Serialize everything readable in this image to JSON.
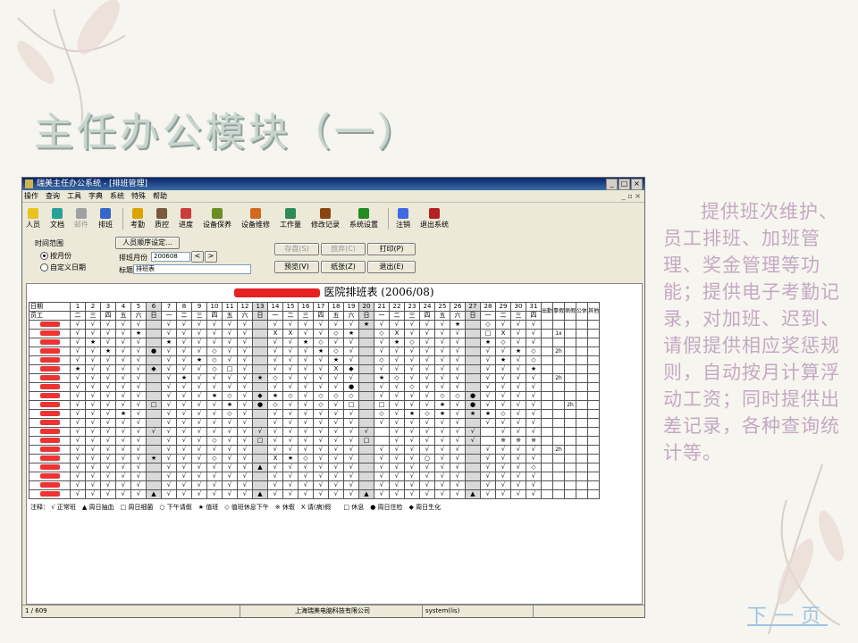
{
  "slide": {
    "title": "主任办公模块（一）",
    "description": "提供班次维护、员工排班、加班管理、奖金管理等功能；提供电子考勤记录，对加班、迟到、请假提供相应奖惩规则，自动按月计算浮动工资；同时提供出差记录，各种查询统计等。",
    "next_link": "下一页"
  },
  "window": {
    "title": "瑞美主任办公系统 - [排班管理]",
    "menu": [
      "操作",
      "查询",
      "工具",
      "字典",
      "系统",
      "特殊",
      "帮助"
    ],
    "toolbar": [
      {
        "label": "人员",
        "icon": "person-icon",
        "color": "#e8c31c",
        "disabled": false
      },
      {
        "label": "文档",
        "icon": "document-icon",
        "color": "#2aa198",
        "disabled": false
      },
      {
        "label": "邮件",
        "icon": "mail-icon",
        "color": "#a0a0a0",
        "disabled": true
      },
      {
        "label": "排班",
        "icon": "schedule-icon",
        "color": "#3866c9",
        "disabled": false
      },
      {
        "label": "考勤",
        "icon": "attendance-icon",
        "color": "#d9a400",
        "disabled": false
      },
      {
        "label": "质控",
        "icon": "quality-icon",
        "color": "#7a5a3a",
        "disabled": false
      },
      {
        "label": "进度",
        "icon": "progress-icon",
        "color": "#c83c3c",
        "disabled": false
      },
      {
        "label": "设备保养",
        "icon": "maintenance-icon",
        "color": "#6b8e23",
        "disabled": false
      },
      {
        "label": "设备维修",
        "icon": "repair-icon",
        "color": "#d2691e",
        "disabled": false
      },
      {
        "label": "工作量",
        "icon": "workload-icon",
        "color": "#2e8b57",
        "disabled": false
      },
      {
        "label": "修改记录",
        "icon": "edit-log-icon",
        "color": "#8b4513",
        "disabled": false
      },
      {
        "label": "系统设置",
        "icon": "settings-icon",
        "color": "#228b22",
        "disabled": false
      },
      {
        "label": "注销",
        "icon": "logout-icon",
        "color": "#4169e1",
        "disabled": false
      },
      {
        "label": "退出系统",
        "icon": "exit-icon",
        "color": "#b22222",
        "disabled": false
      }
    ],
    "panel": {
      "time_range_label": "时间范围",
      "by_month_label": "按月份",
      "custom_date_label": "自定义日期",
      "person_order_button": "人员顺序设定...",
      "month_label": "排班月份",
      "month_value": "200608",
      "title_label": "标题",
      "title_value": "排班表",
      "save_button": "存盘(S)",
      "cancel_button": "放弃(C)",
      "print_button": "打印(P)",
      "preview_button": "预览(V)",
      "paper_button": "纸张(Z)",
      "exit_button": "退出(E)"
    },
    "sheet": {
      "title": "医院排班表 (2006/08)",
      "header_date_label": "日期",
      "header_staff_label": "员工",
      "days": [
        "1",
        "2",
        "3",
        "4",
        "5",
        "6",
        "7",
        "8",
        "9",
        "10",
        "11",
        "12",
        "13",
        "14",
        "15",
        "16",
        "17",
        "18",
        "19",
        "20",
        "21",
        "22",
        "23",
        "24",
        "25",
        "26",
        "27",
        "28",
        "29",
        "30",
        "31"
      ],
      "weekdays": [
        "二",
        "三",
        "四",
        "五",
        "六",
        "日",
        "一",
        "二",
        "三",
        "四",
        "五",
        "六",
        "日",
        "一",
        "二",
        "三",
        "四",
        "五",
        "六",
        "日",
        "一",
        "二",
        "三",
        "四",
        "五",
        "六",
        "日",
        "一",
        "二",
        "三",
        "四"
      ],
      "extra_columns": [
        "出勤",
        "事假",
        "病假",
        "公休",
        "其他"
      ],
      "rows": [
        {
          "cells": "√√√√√_√√√√√√_√√√√√√★√√√√√★_◇√√√",
          "extra": [
            "",
            "",
            "",
            "",
            ""
          ]
        },
        {
          "cells": "√√√√★_√√√√√√_ⅩⅩ√√◇★_◇Ⅹ√√√√_□Ⅹ√√",
          "extra": [
            "",
            "1x",
            "",
            "",
            ""
          ]
        },
        {
          "cells": "√★√√√_★√√√√√_√√★◇√√_√★◇√√√_★◇√√",
          "extra": [
            "",
            "",
            "",
            "",
            ""
          ]
        },
        {
          "cells": "√√★√√●√√√◇√√_√√√★◇√_√√√√√√_√√★◇",
          "extra": [
            "",
            "2h",
            "",
            "",
            ""
          ]
        },
        {
          "cells": "√√√√√_√√★◇√√_√√√√★√_◇√√√√√_√★√◇",
          "extra": [
            "",
            "",
            "",
            "",
            ""
          ]
        },
        {
          "cells": "★√√√√◆√√√◇□√_√√√√Ⅹ◆_√√√√√√_√√√★",
          "extra": [
            "",
            "",
            "",
            "",
            ""
          ]
        },
        {
          "cells": "√√√√√_√★√√√√★◇√√√√√_★◇√√√√_√√√√",
          "extra": [
            "",
            "2h",
            "",
            "",
            ""
          ]
        },
        {
          "cells": "√√√√√_√√√√√√_√√√√√●_√√◇√√√_√√√√",
          "extra": [
            "",
            "",
            "",
            "",
            ""
          ]
        },
        {
          "cells": "√√√√√_√√√★◇√◆★◇√◇◇◇_√√√√◇◇●√√√√",
          "extra": [
            "",
            "",
            "",
            "",
            ""
          ]
        },
        {
          "cells": "√√√√√□√√√√★√●◇√√◇√□_□√√√★√●√√√√",
          "extra": [
            "",
            "",
            "2h",
            "",
            ""
          ]
        },
        {
          "cells": "√√√★√_√√√√◇√_√√√√√√_◇√★◇★√★★◇√√",
          "extra": [
            "",
            "",
            "",
            "",
            ""
          ]
        },
        {
          "cells": "√√√√√_√√√√√√_√√√√√√_√√√√√√_√√√√",
          "extra": [
            "",
            "",
            "",
            "",
            ""
          ]
        },
        {
          "cells": "√√√√√√√√√√√√√√√√√√√√_√√√√√√_√√√√",
          "extra": [
            "",
            "",
            "",
            "",
            ""
          ]
        },
        {
          "cells": "√√√√√_√√√◇√√□√√√√√√□_√√√√√√_※※※※",
          "extra": [
            "",
            "",
            "",
            "",
            ""
          ]
        },
        {
          "cells": "√√√√√_√√√√√√_√√√√√√_√√√√√√_√√√√",
          "extra": [
            "",
            "2h",
            "",
            "",
            ""
          ]
        },
        {
          "cells": "√√√√√★√√√◇√√_Ⅹ★◇√√√_√√√○√√_√√√√",
          "extra": [
            "",
            "",
            "",
            "",
            ""
          ]
        },
        {
          "cells": "√√√√√_√√√√√√▲√√√√√√_√√√√√√_√√√◇",
          "extra": [
            "",
            "",
            "",
            "",
            ""
          ]
        },
        {
          "cells": "√√√√√_√√√√√√_√√√√√√_√√√√√√_√√√√",
          "extra": [
            "",
            "",
            "",
            "",
            ""
          ]
        },
        {
          "cells": "√√√√√_√√√√√√_√√√√√√_√√√√√√_√√√√",
          "extra": [
            "",
            "",
            "",
            "",
            ""
          ]
        },
        {
          "cells": "√√√√√▲√√√√√√▲√√√√√√▲√√√√√√▲√√√√",
          "extra": [
            "",
            "",
            "",
            "",
            ""
          ]
        }
      ],
      "legend": "注释： √ 正常班　▲ 周日抽血　□ 周日细菌　○ 下午请假　★ 值班　◇ 值班休息下午　※ 休假　Ⅹ 请(病)假　　□ 休息　● 周日住检　◆ 周日生化"
    },
    "status": [
      "1 / 609",
      "上海瑞美电脑科技有限公司",
      "system(lis)"
    ]
  }
}
